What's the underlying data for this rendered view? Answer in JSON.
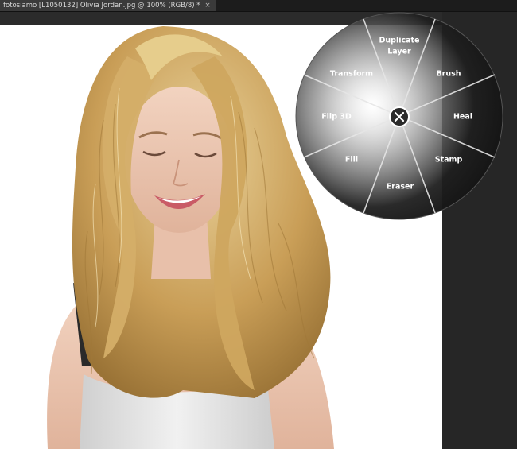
{
  "tab": {
    "title": "fotosiamo [L1050132] Olivia Jordan.jpg @ 100% (RGB/8) *",
    "close_glyph": "×"
  },
  "wheel": {
    "center_icon": "close-icon",
    "items": {
      "duplicate_layer_line1": "Duplicate",
      "duplicate_layer_line2": "Layer",
      "brush": "Brush",
      "heal": "Heal",
      "stamp": "Stamp",
      "eraser": "Eraser",
      "fill": "Fill",
      "flip3d": "Flip 3D",
      "transform": "Transform"
    }
  },
  "colors": {
    "workspace": "#262626",
    "canvas": "#ffffff",
    "hair": "#d8b470",
    "skin": "#eec9b4"
  }
}
